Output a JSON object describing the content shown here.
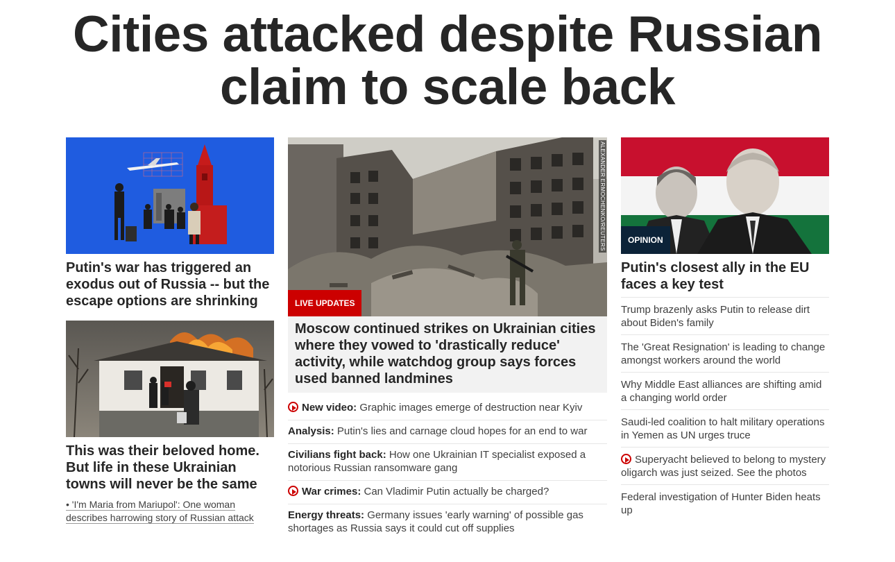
{
  "headline": {
    "line1": "Cities attacked despite Russian",
    "line2": "claim to scale back"
  },
  "left": {
    "card1": {
      "title": "Putin's war has triggered an exodus out of Russia -- but the escape options are shrinking"
    },
    "card2": {
      "title": "This was their beloved home. But life in these Ukrainian towns will never be the same",
      "sub_link": "• 'I'm Maria from Mariupol': One woman describes harrowing story of Russian attack"
    }
  },
  "middle": {
    "tag": "LIVE UPDATES",
    "photo_credit": "ALEXANDER ERMOCHENKO/REUTERS",
    "title": "Moscow continued strikes on Ukrainian cities where they vowed to 'drastically reduce' activity, while watchdog group says forces used banned landmines",
    "items": [
      {
        "label": "New video:",
        "text": " Graphic images emerge of destruction near Kyiv",
        "video": true
      },
      {
        "label": "Analysis:",
        "text": " Putin's lies and carnage cloud hopes for an end to war",
        "video": false
      },
      {
        "label": "Civilians fight back:",
        "text": " How one Ukrainian IT specialist exposed a notorious Russian ransomware gang",
        "video": false
      },
      {
        "label": "War crimes:",
        "text": " Can Vladimir Putin actually be charged?",
        "video": true
      },
      {
        "label": "Energy threats:",
        "text": " Germany issues 'early warning' of possible gas shortages as Russia says it could cut off supplies",
        "video": false
      }
    ]
  },
  "right": {
    "tag": "OPINION",
    "title": "Putin's closest ally in the EU faces a key test",
    "items": [
      {
        "text": "Trump brazenly asks Putin to release dirt about Biden's family",
        "video": false
      },
      {
        "text": "The 'Great Resignation' is leading to change amongst workers around the world",
        "video": false
      },
      {
        "text": "Why Middle East alliances are shifting amid a changing world order",
        "video": false
      },
      {
        "text": "Saudi-led coalition to halt military operations in Yemen as UN urges truce",
        "video": false
      },
      {
        "text": "Superyacht believed to belong to mystery oligarch was just seized. See the photos",
        "video": true
      },
      {
        "text": "Federal investigation of Hunter Biden heats up",
        "video": false
      }
    ]
  },
  "colors": {
    "live_red": "#cc0000",
    "opinion_navy": "#0c2338",
    "illustration_blue": "#1f5ce0"
  }
}
